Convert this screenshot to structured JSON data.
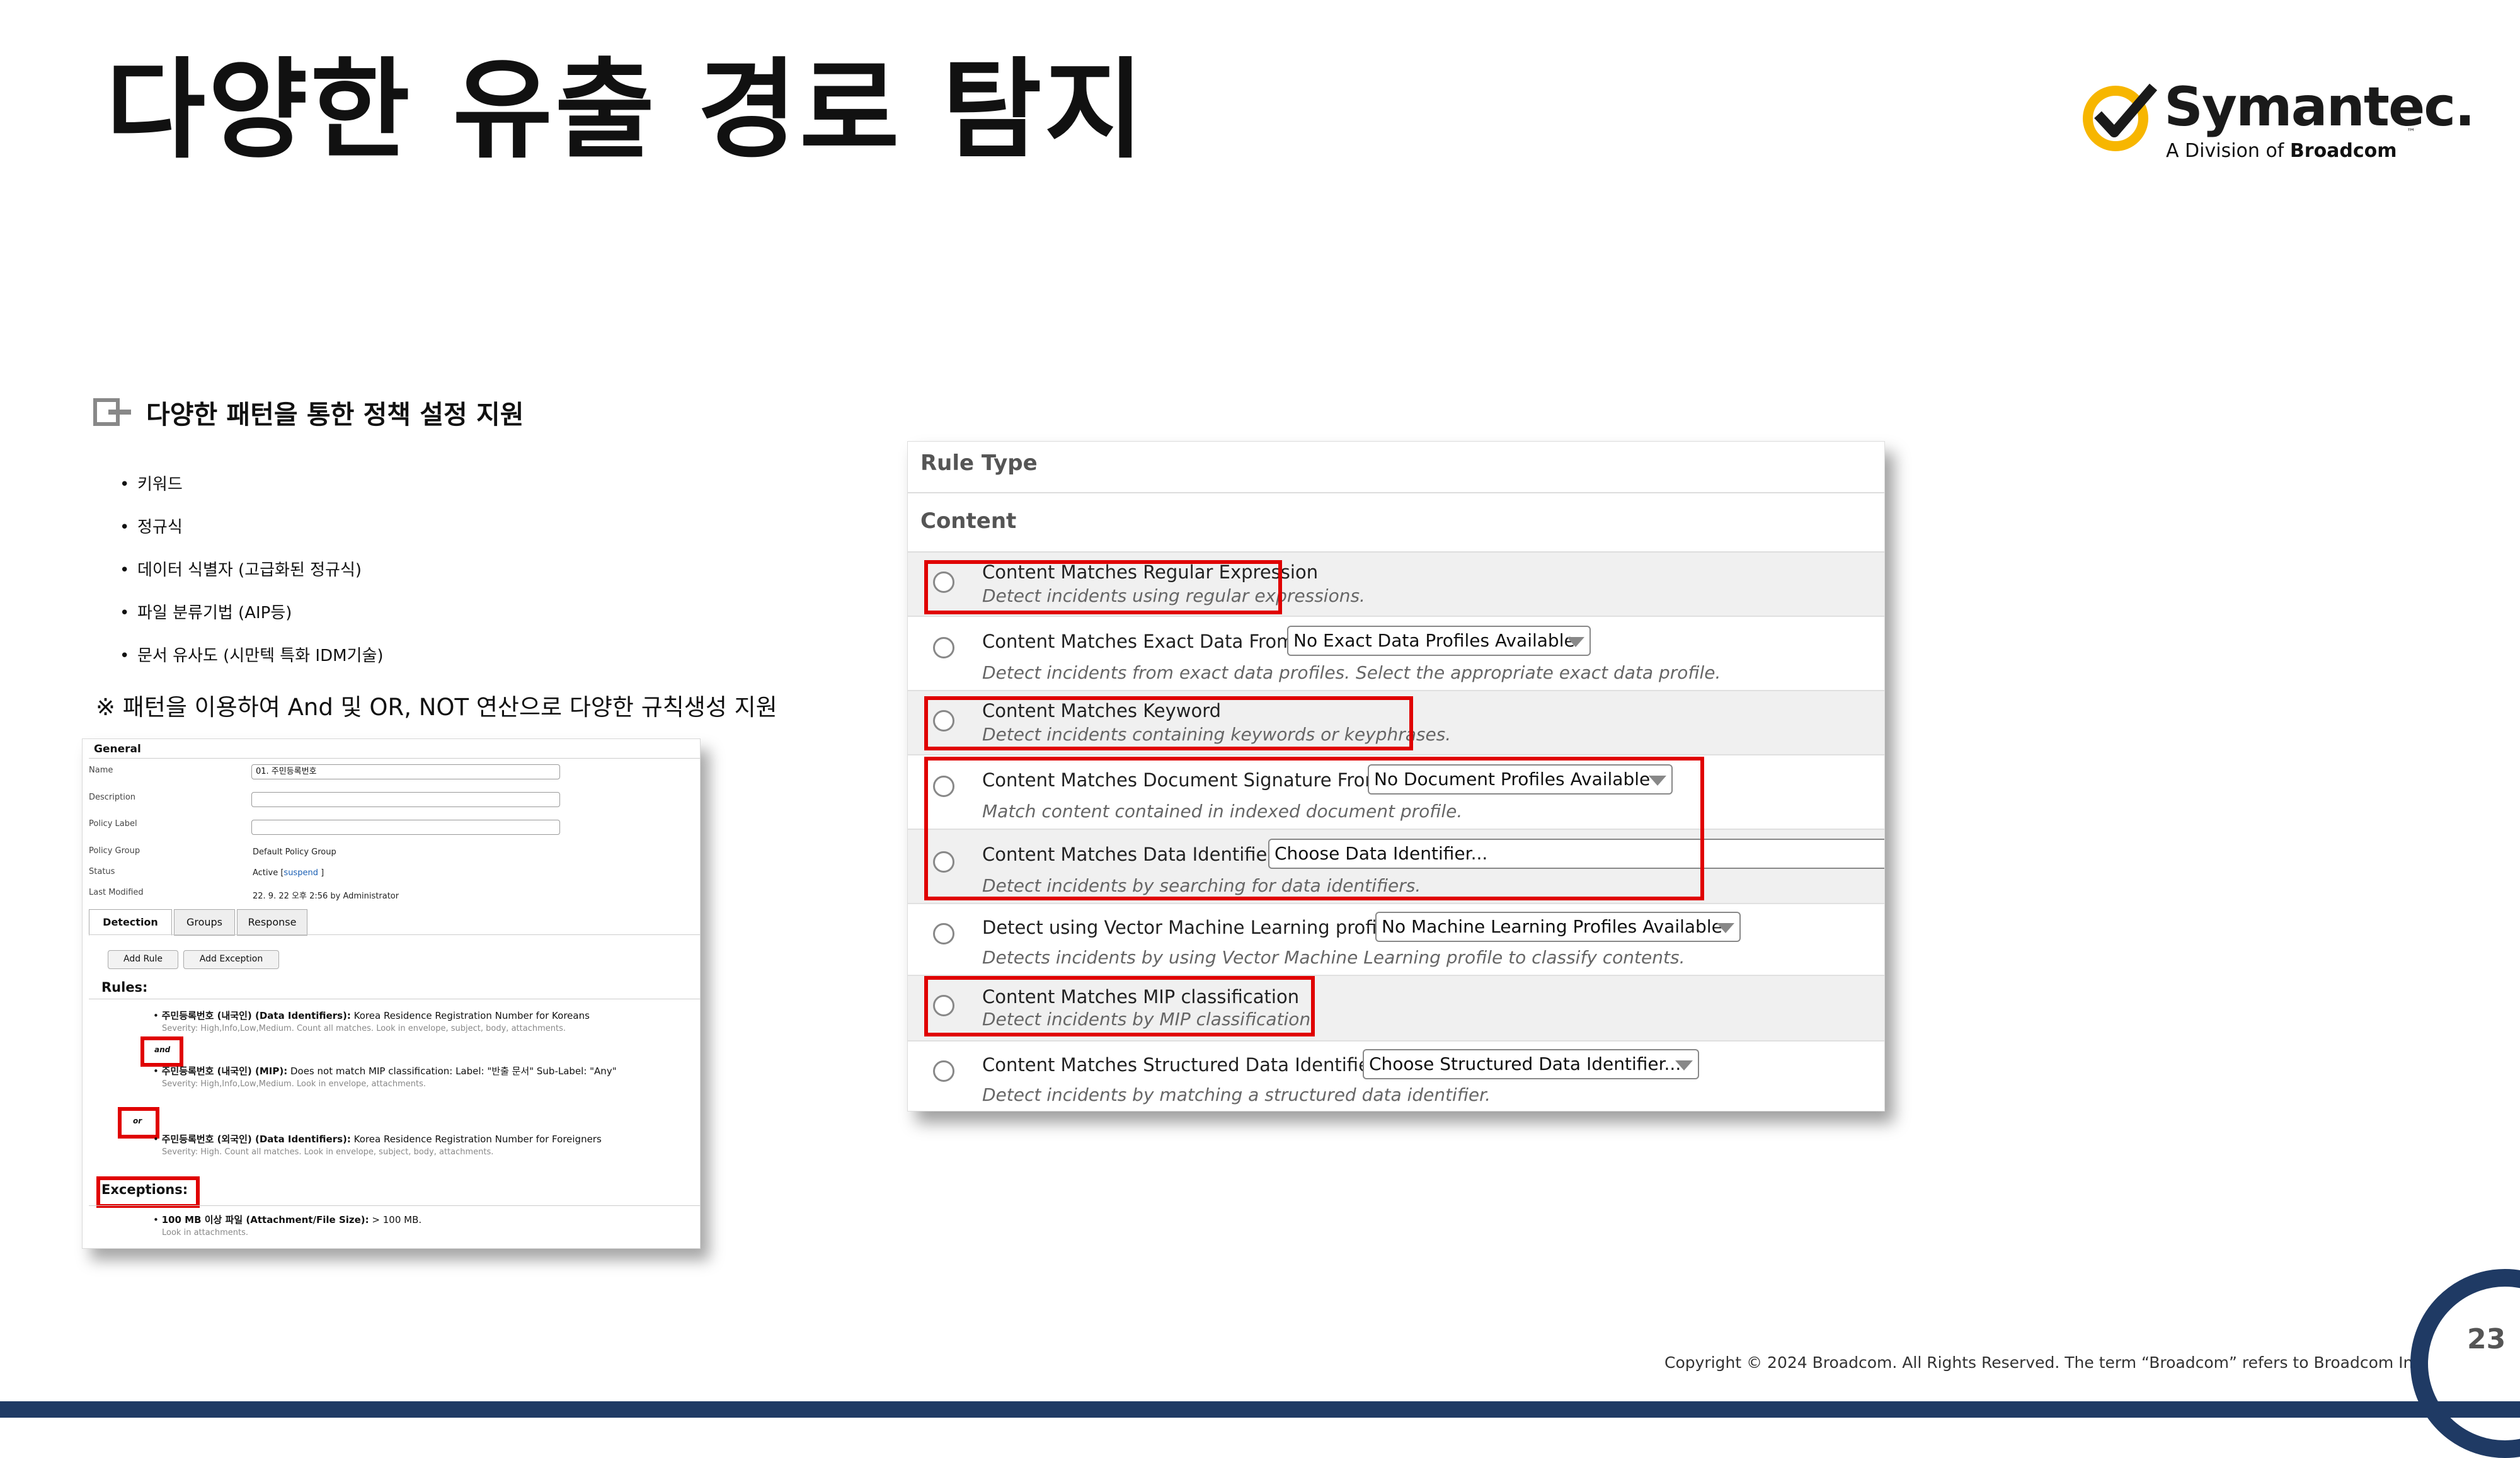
{
  "slide": {
    "title": "다양한 유출 경로 탐지",
    "page_number": "23",
    "copyright": "Copyright © 2024 Broadcom.  All Rights Reserved. The term “Broadcom” refers to Broadcom Inc."
  },
  "logo": {
    "name": "Symantec.",
    "tm": "™",
    "sub_prefix": "A Division of ",
    "sub_brand": "Broadcom",
    "colors": {
      "ring": "#f7b600",
      "check": "#1a1a1a"
    }
  },
  "section": {
    "heading": "다양한 패턴을 통한 정책 설정 지원",
    "bullets": [
      "키워드",
      "정규식",
      "데이터 식별자 (고급화된 정규식)",
      "파일 분류기법 (AIP등)",
      "문서 유사도 (시만텍 특화 IDM기술)"
    ],
    "note": "※ 패턴을 이용하여 And 및 OR, NOT 연산으로 다양한 규칙생성 지원"
  },
  "policy_editor": {
    "general_label": "General",
    "fields": [
      {
        "label": "Name",
        "value": "01. 주민등록번호"
      },
      {
        "label": "Description",
        "value": ""
      },
      {
        "label": "Policy Label",
        "value": ""
      },
      {
        "label": "Policy Group",
        "value": "Default Policy Group"
      },
      {
        "label": "Status",
        "value": "Active [",
        "link": "suspend",
        "suffix": " ]"
      },
      {
        "label": "Last Modified",
        "value": "22. 9. 22 오후 2:56 by Administrator"
      }
    ],
    "tabs": [
      "Detection",
      "Groups",
      "Response"
    ],
    "buttons": {
      "add_rule": "Add Rule",
      "add_exception": "Add Exception"
    },
    "rules_label": "Rules:",
    "rules": [
      {
        "title": "주민등록번호 (내국인) (Data Identifiers):",
        "detail": " Korea Residence Registration Number for Koreans",
        "severity": "Severity: High,Info,Low,Medium. Count all matches. Look in envelope, subject, body, attachments."
      },
      {
        "title": "주민등록번호 (내국인) (MIP):",
        "detail": " Does not match MIP classification: Label: \"반출 문서\" Sub-Label: \"Any\"",
        "severity": "Severity: High,Info,Low,Medium. Look in envelope, attachments."
      },
      {
        "title": "주민등록번호 (외국인) (Data Identifiers):",
        "detail": " Korea Residence Registration Number for Foreigners",
        "severity": "Severity: High. Count all matches. Look in envelope, subject, body, attachments."
      }
    ],
    "operators": {
      "and": "and",
      "or": "or"
    },
    "exceptions_label": "Exceptions:",
    "exception": {
      "title": "100 MB 이상 파일 (Attachment/File Size):",
      "detail": " > 100 MB.",
      "sub": "Look in attachments."
    }
  },
  "rule_type_panel": {
    "rule_type_label": "Rule Type",
    "content_label": "Content",
    "rows": [
      {
        "title": "Content Matches Regular Expression",
        "desc": "Detect incidents using regular expressions."
      },
      {
        "title": "Content Matches Exact Data From:",
        "select": "No Exact Data Profiles Available",
        "desc": "Detect incidents from exact data profiles. Select the appropriate exact data profile."
      },
      {
        "title": "Content Matches Keyword",
        "desc": "Detect incidents containing keywords or keyphrases."
      },
      {
        "title": "Content Matches Document Signature From:",
        "select": "No Document Profiles Available",
        "desc": "Match content contained in indexed document profile."
      },
      {
        "title": "Content Matches Data Identifier:",
        "select": "Choose Data Identifier...",
        "desc": "Detect incidents by searching for data identifiers."
      },
      {
        "title": "Detect using Vector Machine Learning profile:",
        "select": "No Machine Learning Profiles Available",
        "desc": "Detects incidents by using Vector Machine Learning profile to classify contents."
      },
      {
        "title": "Content Matches MIP classification",
        "desc": "Detect incidents by MIP classification."
      },
      {
        "title": "Content Matches Structured Data Identifier:",
        "select": "Choose Structured Data Identifier...",
        "desc": "Detect incidents by matching a structured data identifier."
      }
    ]
  },
  "colors": {
    "highlight": "#e00000",
    "navy": "#1f3a64"
  }
}
